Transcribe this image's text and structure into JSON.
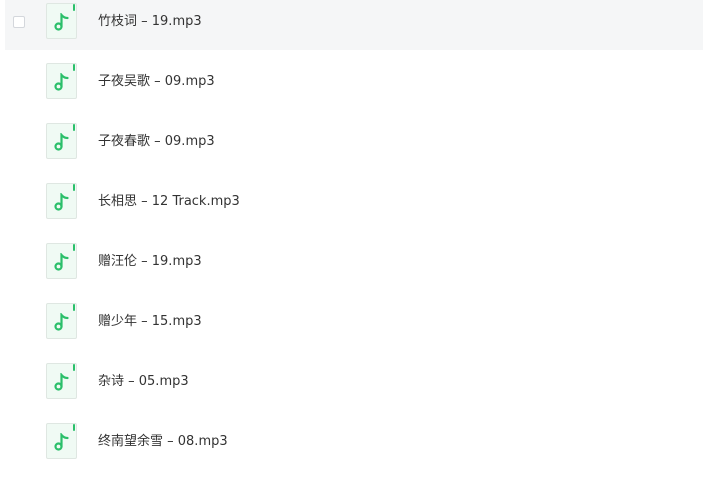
{
  "accent_color": "#2bbf6a",
  "file_icon": "music-note-icon",
  "files": [
    {
      "name": "竹枝词 – 19.mp3"
    },
    {
      "name": "子夜吴歌 – 09.mp3"
    },
    {
      "name": "子夜春歌 – 09.mp3"
    },
    {
      "name": "长相思 – 12 Track.mp3"
    },
    {
      "name": "赠汪伦 – 19.mp3"
    },
    {
      "name": "赠少年 – 15.mp3"
    },
    {
      "name": "杂诗 – 05.mp3"
    },
    {
      "name": "终南望余雪 – 08.mp3"
    }
  ]
}
